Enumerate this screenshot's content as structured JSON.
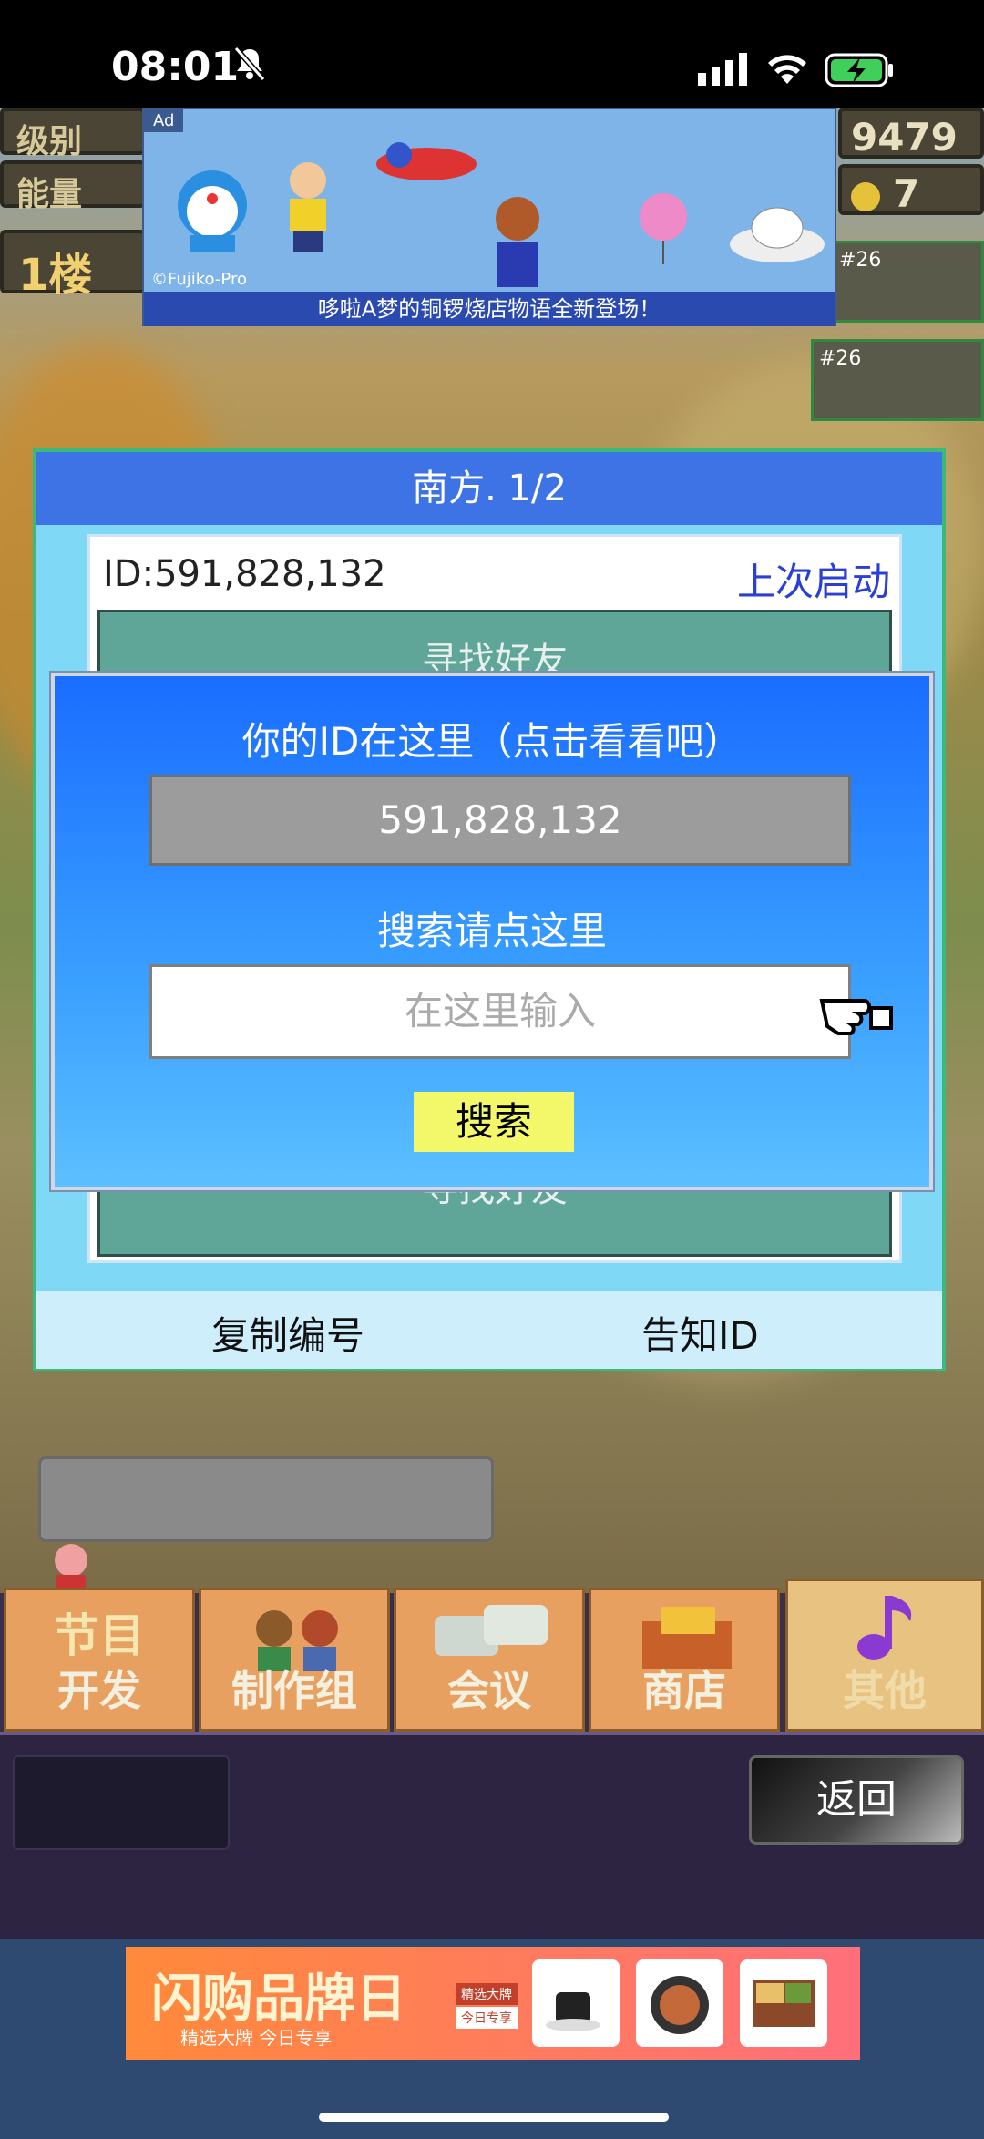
{
  "status_bar": {
    "time": "08:01"
  },
  "hud": {
    "level_label": "级别",
    "energy_label": "能量",
    "floor_label": "1楼",
    "money": "9479",
    "coins": "7",
    "item_badge_1": "#26",
    "item_badge_2": "#26"
  },
  "ad_top": {
    "badge": "Ad",
    "copyright": "©Fujiko-Pro",
    "caption": "哆啦A梦的铜锣烧店物语全新登场！"
  },
  "panel": {
    "title": "南方. 1/2",
    "id_text": "ID:591,828,132",
    "last_launch": "上次启动",
    "list_hint_top": "寻找好友",
    "list_hint_bottom": "寻找好友",
    "footer_copy": "复制编号",
    "footer_notify": "告知ID"
  },
  "overlay": {
    "your_id_label": "你的ID在这里（点击看看吧）",
    "id_value": "591,828,132",
    "search_label": "搜索请点这里",
    "search_placeholder": "在这里输入",
    "search_button": "搜索"
  },
  "tabs": [
    {
      "top": "节目",
      "bottom": "开发"
    },
    {
      "bottom": "制作组"
    },
    {
      "bottom": "会议"
    },
    {
      "bottom": "商店"
    },
    {
      "bottom": "其他"
    }
  ],
  "back_button": "返回",
  "ad_bottom": {
    "headline": "闪购品牌日",
    "sub": "精选大牌 今日专享",
    "tag1": "精选大牌",
    "tag2": "今日专享"
  },
  "colors": {
    "overlay_blue": "#1a6dff",
    "panel_header": "#3e73e6",
    "search_button": "#f3f86a",
    "link_blue": "#2a3fd6"
  }
}
